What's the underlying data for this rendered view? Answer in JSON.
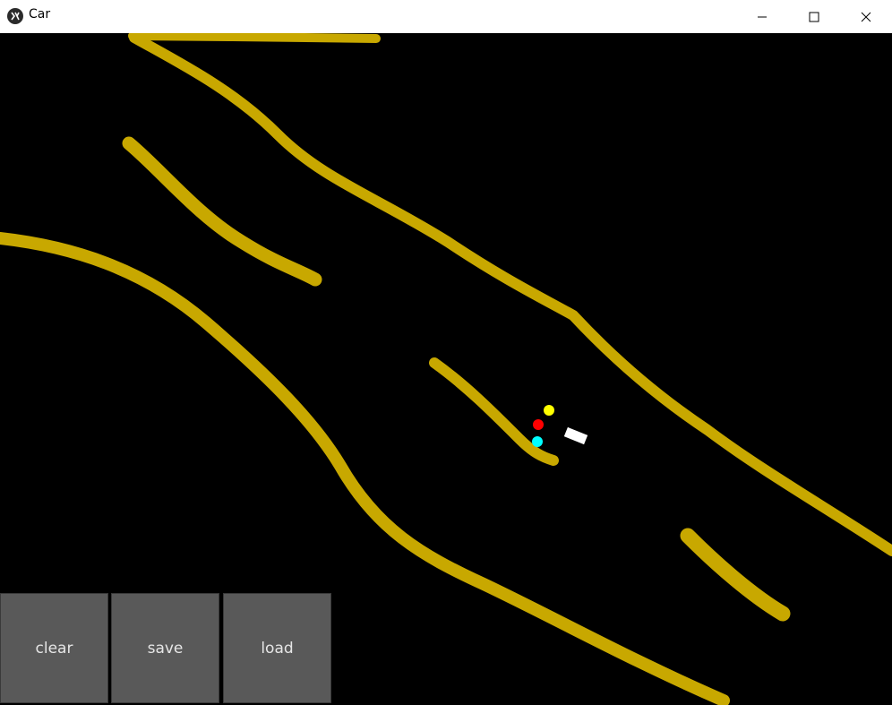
{
  "window": {
    "title": "Car",
    "app_icon": "kivy-icon",
    "controls": [
      "minimize-icon",
      "maximize-icon",
      "close-icon"
    ]
  },
  "canvas": {
    "background_color": "#000000",
    "track_color": "#c8a800",
    "car_color": "#ffffff",
    "sensor_colors": [
      "#ffff00",
      "#ff0000",
      "#00ffff"
    ]
  },
  "toolbar": {
    "clear_label": "clear",
    "save_label": "save",
    "load_label": "load"
  }
}
